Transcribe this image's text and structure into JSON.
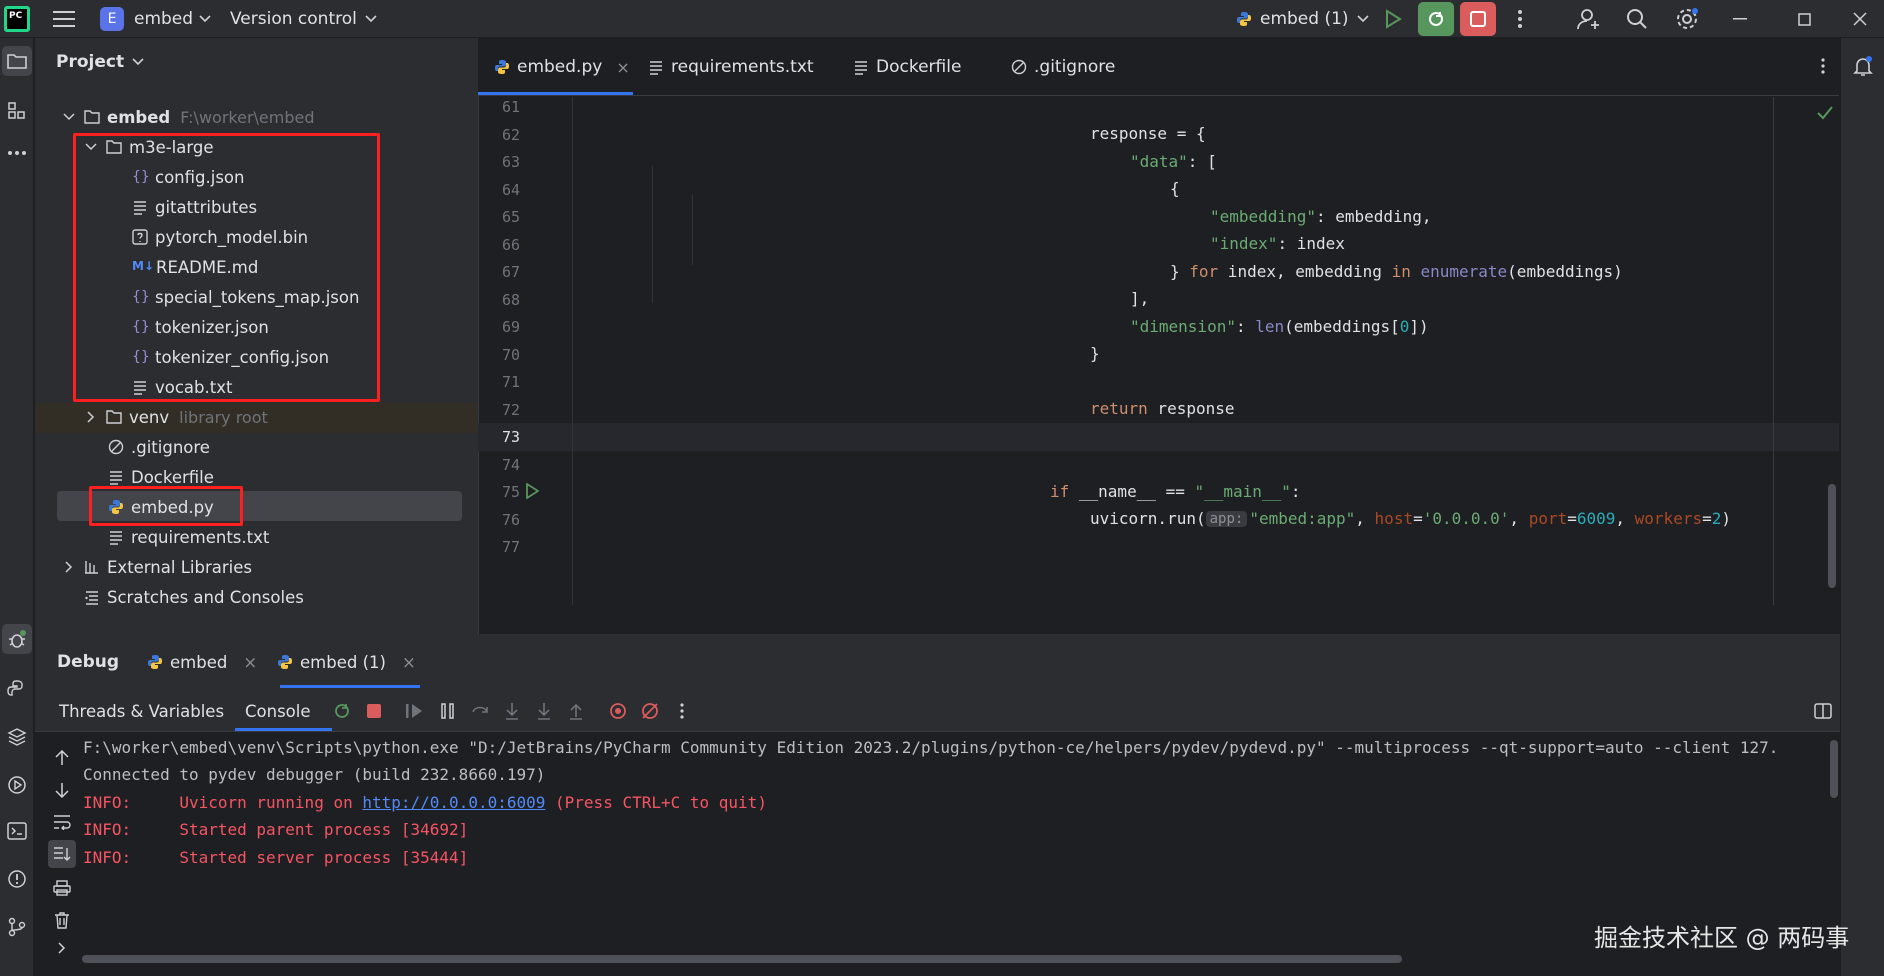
{
  "titlebar": {
    "app_logo": "PC",
    "project_badge": "E",
    "project_name": "embed",
    "vcs_label": "Version control",
    "run_config": "embed (1)"
  },
  "project_panel": {
    "title": "Project",
    "root": {
      "name": "embed",
      "path": "F:\\worker\\embed"
    },
    "folder_m3e": "m3e-large",
    "m3e_files": [
      {
        "name": "config.json",
        "icon": "json-icon"
      },
      {
        "name": "gitattributes",
        "icon": "text-file-icon"
      },
      {
        "name": "pytorch_model.bin",
        "icon": "unknown-file-icon"
      },
      {
        "name": "README.md",
        "icon": "markdown-icon"
      },
      {
        "name": "special_tokens_map.json",
        "icon": "json-icon"
      },
      {
        "name": "tokenizer.json",
        "icon": "json-icon"
      },
      {
        "name": "tokenizer_config.json",
        "icon": "json-icon"
      },
      {
        "name": "vocab.txt",
        "icon": "text-file-icon"
      }
    ],
    "venv": {
      "name": "venv",
      "sub": "library root"
    },
    "root_files": [
      {
        "name": ".gitignore",
        "icon": "ignore-icon"
      },
      {
        "name": "Dockerfile",
        "icon": "text-file-icon"
      },
      {
        "name": "embed.py",
        "icon": "python-icon"
      },
      {
        "name": "requirements.txt",
        "icon": "text-file-icon"
      }
    ],
    "external_libraries": "External Libraries",
    "scratches": "Scratches and Consoles"
  },
  "editor": {
    "tabs": [
      {
        "label": "embed.py",
        "icon": "python-icon",
        "active": true,
        "close": "×"
      },
      {
        "label": "requirements.txt",
        "icon": "text-file-icon"
      },
      {
        "label": "Dockerfile",
        "icon": "text-file-icon"
      },
      {
        "label": ".gitignore",
        "icon": "ignore-icon"
      }
    ],
    "line_numbers": [
      "61",
      "62",
      "63",
      "64",
      "65",
      "66",
      "67",
      "68",
      "69",
      "70",
      "71",
      "72",
      "73",
      "74",
      "75",
      "76",
      "77"
    ],
    "code": {
      "l62a": "response = {",
      "l63a": "\"data\"",
      "l63b": ": [",
      "l64a": "{",
      "l65a": "\"embedding\"",
      "l65b": ": embedding,",
      "l66a": "\"index\"",
      "l66b": ": index",
      "l67a": "} ",
      "l67b": "for",
      "l67c": " index, embedding ",
      "l67d": "in",
      "l67e": " ",
      "l67f": "enumerate",
      "l67g": "(embeddings)",
      "l68a": "],",
      "l69a": "\"dimension\"",
      "l69b": ": ",
      "l69c": "len",
      "l69d": "(embeddings[",
      "l69e": "0",
      "l69f": "])",
      "l70a": "}",
      "l72a": "return",
      "l72b": " response",
      "l75a": "if",
      "l75b": " __name__ == ",
      "l75c": "\"__main__\"",
      "l75d": ":",
      "l76a": "uvicorn.run(",
      "l76hint": "app:",
      "l76b": "\"embed:app\"",
      "l76c": ", ",
      "l76d": "host",
      "l76e": "=",
      "l76f": "'0.0.0.0'",
      "l76g": ", ",
      "l76h": "port",
      "l76i": "=",
      "l76j": "6009",
      "l76k": ", ",
      "l76l": "workers",
      "l76m": "=",
      "l76n": "2",
      "l76o": ")"
    }
  },
  "debug": {
    "title": "Debug",
    "sessions": [
      {
        "label": "embed",
        "close": "×"
      },
      {
        "label": "embed (1)",
        "close": "×",
        "active": true
      }
    ],
    "tabs": [
      "Threads & Variables",
      "Console"
    ],
    "console": [
      {
        "text": "F:\\worker\\embed\\venv\\Scripts\\python.exe \"D:/JetBrains/PyCharm Community Edition 2023.2/plugins/python-ce/helpers/pydev/pydevd.py\" --multiprocess --qt-support=auto --client 127.",
        "style": "gray"
      },
      {
        "text": "Connected to pydev debugger (build 232.8660.197)",
        "style": "gray"
      }
    ],
    "info1": {
      "prefix": "INFO:     Uvicorn running on ",
      "link": "http://0.0.0.0:6009",
      "suffix": " (Press CTRL+C to quit)"
    },
    "info2": "INFO:     Started parent process [34692]",
    "info3": "INFO:     Started server process [35444]"
  },
  "watermark": "掘金技术社区 @ 两码事",
  "colors": {
    "highlight": "#ff1f1f",
    "accent": "#3574f0",
    "run_green": "#57965c",
    "stop_red": "#db5c5c"
  }
}
